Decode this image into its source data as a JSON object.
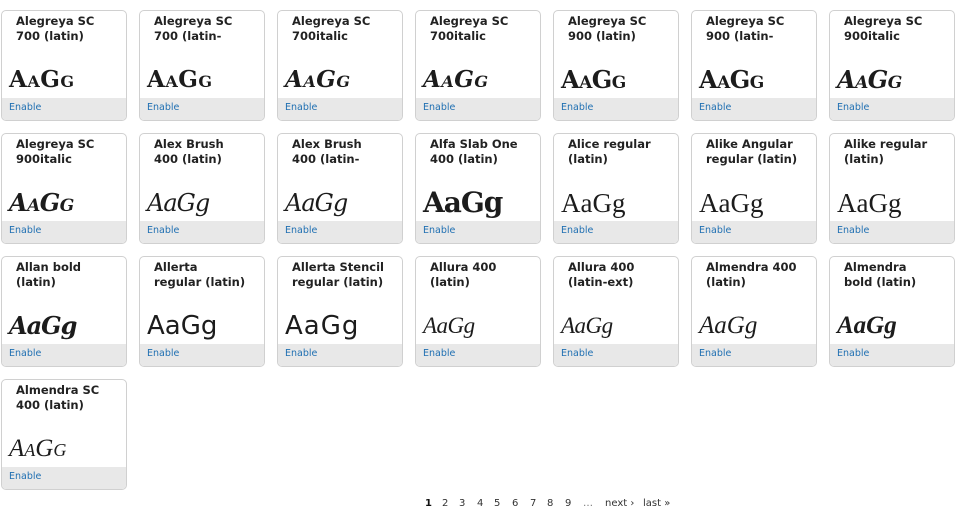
{
  "fonts": [
    {
      "name": "Alegreya SC\n700 (latin)",
      "sample": "AaGg",
      "style": "s-scb",
      "enable": "Enable"
    },
    {
      "name": "Alegreya SC\n700 (latin-",
      "sample": "AaGg",
      "style": "s-scb",
      "enable": "Enable"
    },
    {
      "name": "Alegreya SC\n700italic",
      "sample": "AaGg",
      "style": "s-scbi",
      "enable": "Enable"
    },
    {
      "name": "Alegreya SC\n700italic",
      "sample": "AaGg",
      "style": "s-scbi",
      "enable": "Enable"
    },
    {
      "name": "Alegreya SC\n900 (latin)",
      "sample": "AaGg",
      "style": "s-scx",
      "enable": "Enable"
    },
    {
      "name": "Alegreya SC\n900 (latin-",
      "sample": "AaGg",
      "style": "s-scx",
      "enable": "Enable"
    },
    {
      "name": "Alegreya SC\n900italic",
      "sample": "AaGg",
      "style": "s-scxi",
      "enable": "Enable"
    },
    {
      "name": "Alegreya SC\n900italic",
      "sample": "AaGg",
      "style": "s-scxi",
      "enable": "Enable"
    },
    {
      "name": "Alex Brush\n400 (latin)",
      "sample": "AaGg",
      "style": "s-brush",
      "enable": "Enable"
    },
    {
      "name": "Alex Brush\n400 (latin-",
      "sample": "AaGg",
      "style": "s-brush",
      "enable": "Enable"
    },
    {
      "name": "Alfa Slab One\n400 (latin)",
      "sample": "AaGg",
      "style": "s-slab",
      "enable": "Enable"
    },
    {
      "name": "Alice regular\n(latin)",
      "sample": "AaGg",
      "style": "s-serif",
      "enable": "Enable"
    },
    {
      "name": "Alike Angular\nregular (latin)",
      "sample": "AaGg",
      "style": "s-serif",
      "enable": "Enable"
    },
    {
      "name": "Alike regular\n(latin)",
      "sample": "AaGg",
      "style": "s-serif",
      "enable": "Enable"
    },
    {
      "name": "Allan bold\n(latin)",
      "sample": "AaGg",
      "style": "s-allan",
      "enable": "Enable"
    },
    {
      "name": "Allerta\nregular (latin)",
      "sample": "AaGg",
      "style": "s-sans",
      "enable": "Enable"
    },
    {
      "name": "Allerta Stencil\nregular (latin)",
      "sample": "AaGg",
      "style": "s-stencil",
      "enable": "Enable"
    },
    {
      "name": "Allura 400\n(latin)",
      "sample": "AaGg",
      "style": "s-allura",
      "enable": "Enable"
    },
    {
      "name": "Allura 400\n(latin-ext)",
      "sample": "AaGg",
      "style": "s-allura",
      "enable": "Enable"
    },
    {
      "name": "Almendra 400\n(latin)",
      "sample": "AaGg",
      "style": "s-almendra",
      "enable": "Enable"
    },
    {
      "name": "Almendra\nbold (latin)",
      "sample": "AaGg",
      "style": "s-almendrab",
      "enable": "Enable"
    },
    {
      "name": "Almendra SC\n400 (latin)",
      "sample": "AaGg",
      "style": "s-almsc",
      "enable": "Enable"
    }
  ],
  "pager": {
    "current": "1",
    "pages": [
      "2",
      "3",
      "4",
      "5",
      "6",
      "7",
      "8",
      "9"
    ],
    "ellipsis": "…",
    "next": "next ›",
    "last": "last »"
  },
  "colors": {
    "link": "#1f6fb2",
    "card_footer": "#e8e8e8",
    "card_border": "#d0d0d0"
  }
}
